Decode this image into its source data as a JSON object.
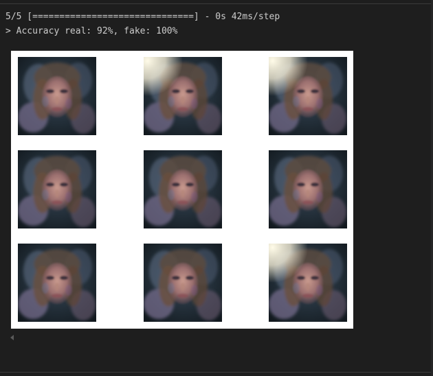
{
  "output": {
    "progress_line": "5/5 [==============================] - 0s 42ms/step",
    "accuracy_line": "> Accuracy real: 92%, fake: 100%"
  },
  "figure": {
    "grid_rows": 3,
    "grid_cols": 3,
    "tiles": [
      {
        "name": "generated-face-1",
        "variant": "dark"
      },
      {
        "name": "generated-face-2",
        "variant": "bright-corner"
      },
      {
        "name": "generated-face-3",
        "variant": "bright-corner"
      },
      {
        "name": "generated-face-4",
        "variant": "dark"
      },
      {
        "name": "generated-face-5",
        "variant": "dark"
      },
      {
        "name": "generated-face-6",
        "variant": "dark"
      },
      {
        "name": "generated-face-7",
        "variant": "dark"
      },
      {
        "name": "generated-face-8",
        "variant": "dark"
      },
      {
        "name": "generated-face-9",
        "variant": "bright-corner"
      }
    ]
  },
  "colors": {
    "background": "#1e1e1e",
    "text": "#cccccc",
    "figure_background": "#ffffff"
  }
}
